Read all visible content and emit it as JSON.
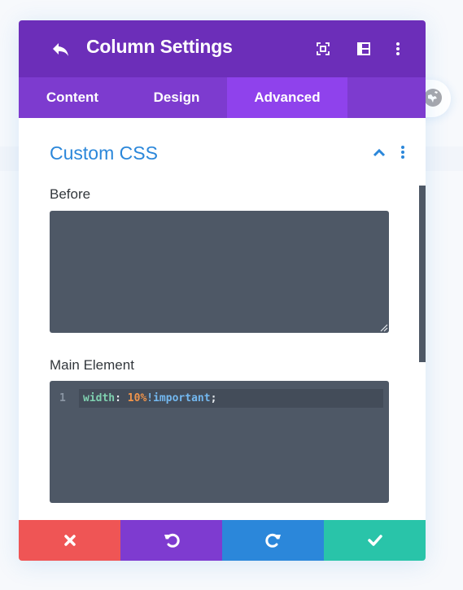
{
  "header": {
    "title": "Column Settings",
    "icons": [
      "back-arrow-icon",
      "fullscreen-icon",
      "split-view-icon",
      "more-vertical-icon"
    ]
  },
  "tabs": [
    {
      "label": "Content",
      "active": false
    },
    {
      "label": "Design",
      "active": false
    },
    {
      "label": "Advanced",
      "active": true
    }
  ],
  "section": {
    "title": "Custom CSS",
    "expanded": true
  },
  "fields": [
    {
      "label": "Before",
      "value": ""
    },
    {
      "label": "Main Element",
      "line_number": "1",
      "code_tokens": {
        "property": "width",
        "colon": ": ",
        "value": "10%",
        "important": "!important",
        "semicolon": ";"
      },
      "value": "width: 10%!important;"
    }
  ],
  "footer": {
    "buttons": [
      {
        "name": "discard",
        "icon": "close-icon",
        "color": "#ef5555"
      },
      {
        "name": "undo",
        "icon": "undo-icon",
        "color": "#7e3bd0"
      },
      {
        "name": "redo",
        "icon": "redo-icon",
        "color": "#2b87da"
      },
      {
        "name": "save",
        "icon": "check-icon",
        "color": "#29c4a9"
      }
    ]
  },
  "colors": {
    "header": "#6c2eb9",
    "tabs": "#7d3bcf",
    "active_tab": "#8f42ec",
    "section_title": "#2b87da",
    "code_bg": "#4e5866",
    "token_property": "#7fd1b0",
    "token_value": "#f0944b",
    "token_important": "#73b8f0"
  }
}
